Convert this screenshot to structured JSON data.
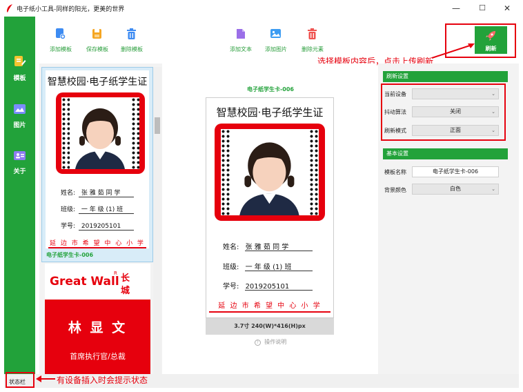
{
  "window": {
    "title": "电子纸小工具-同样的阳光，更美的世界",
    "controls": {
      "minimize": "—",
      "maximize": "☐",
      "close": "✕"
    }
  },
  "sidebar": {
    "items": [
      {
        "label": "模板",
        "icon": "template-icon"
      },
      {
        "label": "图片",
        "icon": "image-icon"
      },
      {
        "label": "关于",
        "icon": "about-icon"
      }
    ]
  },
  "toolbar": {
    "add_template": "添加模板",
    "save_template": "保存模板",
    "delete_template": "删除模板",
    "add_text": "添加文本",
    "add_image": "添加图片",
    "delete_element": "删除元素",
    "refresh": "刷新"
  },
  "annotations": {
    "refresh_hint": "选择模板内容后，点击上传刷新",
    "status_hint": "有设备插入时会提示状态"
  },
  "templates": [
    {
      "name": "电子纸学生卡-006",
      "title": "智慧校园·电子纸学生证",
      "fields": [
        {
          "label": "姓名:",
          "value": "张 雅 茹 同 学"
        },
        {
          "label": "班级:",
          "value": "一 年 级 (1) 班"
        },
        {
          "label": "学号:",
          "value": "2019205101"
        }
      ],
      "school": "延 边 市 希 望 中 心 小 学"
    },
    {
      "brand": "Great Wall",
      "brand_mark": "R",
      "brand_cn_1": "长",
      "brand_cn_2": "城",
      "person": "林 显 文",
      "position": "首席执行官/总裁"
    }
  ],
  "canvas": {
    "template_name": "电子纸学生卡-006",
    "card_title": "智慧校园·电子纸学生证",
    "fields": [
      {
        "label": "姓名:",
        "value": "张 雅 茹 同 学"
      },
      {
        "label": "班级:",
        "value": "一 年 级 (1) 班"
      },
      {
        "label": "学号:",
        "value": "2019205101"
      }
    ],
    "school": "延 边 市 希 望 中 心 小 学",
    "size_info": "3.7寸 240(W)*416(H)px",
    "help": "操作说明",
    "help_icon": "?"
  },
  "settings": {
    "refresh_header": "刷新设置",
    "current_device_label": "当前设备",
    "current_device_value": "",
    "dither_label": "抖动算法",
    "dither_value": "关闭",
    "refresh_mode_label": "刷新模式",
    "refresh_mode_value": "正面",
    "basic_header": "基本设置",
    "template_name_label": "模板名称",
    "template_name_value": "电子纸学生卡-006",
    "bg_color_label": "背景颜色",
    "bg_color_value": "白色"
  },
  "statusbar": {
    "text": "状态栏"
  },
  "colors": {
    "accent_green": "#22a23a",
    "highlight_red": "#e6000d"
  }
}
